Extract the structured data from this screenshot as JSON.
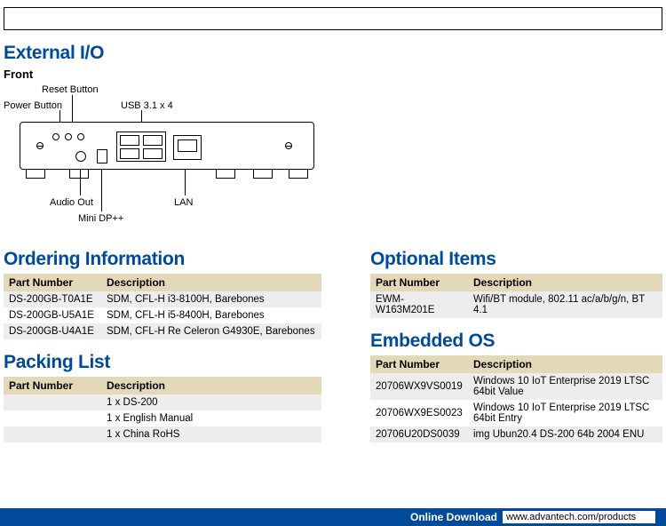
{
  "sections": {
    "external_io": "External I/O",
    "front": "Front",
    "ordering": "Ordering Information",
    "packing": "Packing List",
    "optional": "Optional Items",
    "embedded": "Embedded OS"
  },
  "callouts": {
    "reset_button": "Reset Button",
    "power_button": "Power Button",
    "usb": "USB 3.1 x 4",
    "audio_out": "Audio Out",
    "mini_dp": "Mini DP++",
    "lan": "LAN"
  },
  "table_headers": {
    "part_number": "Part Number",
    "description": "Description"
  },
  "ordering": [
    {
      "pn": "DS-200GB-T0A1E",
      "desc": "SDM, CFL-H i3-8100H, Barebones"
    },
    {
      "pn": "DS-200GB-U5A1E",
      "desc": "SDM, CFL-H i5-8400H, Barebones"
    },
    {
      "pn": "DS-200GB-U4A1E",
      "desc": "SDM, CFL-H Re Celeron G4930E, Barebones"
    }
  ],
  "packing": [
    {
      "pn": "",
      "desc": "1 x DS-200"
    },
    {
      "pn": "",
      "desc": "1 x English Manual"
    },
    {
      "pn": "",
      "desc": "1 x China RoHS"
    }
  ],
  "optional": [
    {
      "pn": "EWM-W163M201E",
      "desc": "Wifi/BT module, 802.11 ac/a/b/g/n, BT 4.1"
    }
  ],
  "embedded": [
    {
      "pn": "20706WX9VS0019",
      "desc": "Windows 10 IoT Enterprise 2019 LTSC 64bit Value"
    },
    {
      "pn": "20706WX9ES0023",
      "desc": "Windows 10 IoT Enterprise 2019 LTSC 64bit Entry"
    },
    {
      "pn": "20706U20DS0039",
      "desc": "img Ubun20.4 DS-200 64b 2004 ENU"
    }
  ],
  "footer": {
    "label": "Online Download",
    "url": "www.advantech.com/products"
  }
}
